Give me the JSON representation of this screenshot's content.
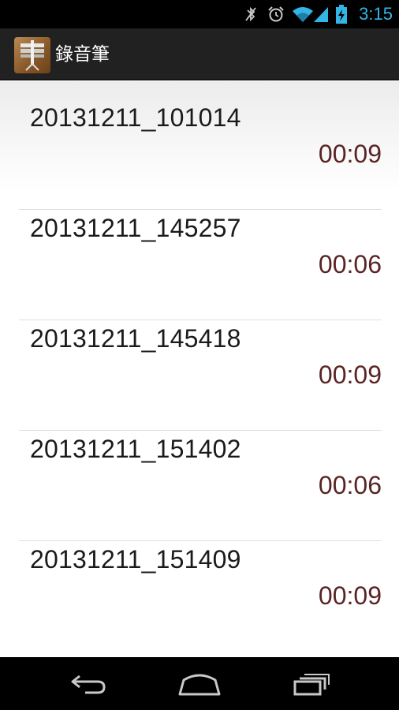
{
  "status_bar": {
    "time": "3:15",
    "icons": [
      "bluetooth-off-icon",
      "alarm-icon",
      "wifi-icon",
      "signal-icon",
      "battery-charging-icon"
    ],
    "accent_color": "#33b5e5"
  },
  "action_bar": {
    "title": "錄音筆",
    "app_icon": "microphone-app-icon"
  },
  "recordings": [
    {
      "name": "20131211_101014",
      "duration": "00:09"
    },
    {
      "name": "20131211_145257",
      "duration": "00:06"
    },
    {
      "name": "20131211_145418",
      "duration": "00:09"
    },
    {
      "name": "20131211_151402",
      "duration": "00:06"
    },
    {
      "name": "20131211_151409",
      "duration": "00:09"
    }
  ],
  "nav_bar": {
    "buttons": [
      "back-icon",
      "home-icon",
      "recent-apps-icon"
    ]
  }
}
